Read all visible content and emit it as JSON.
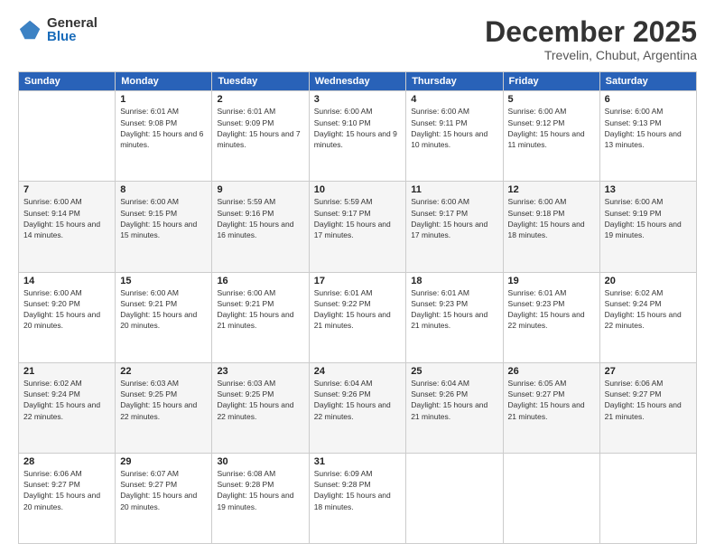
{
  "header": {
    "logo_general": "General",
    "logo_blue": "Blue",
    "month_title": "December 2025",
    "subtitle": "Trevelin, Chubut, Argentina"
  },
  "days_of_week": [
    "Sunday",
    "Monday",
    "Tuesday",
    "Wednesday",
    "Thursday",
    "Friday",
    "Saturday"
  ],
  "weeks": [
    [
      {
        "day": "",
        "sunrise": "",
        "sunset": "",
        "daylight": ""
      },
      {
        "day": "1",
        "sunrise": "Sunrise: 6:01 AM",
        "sunset": "Sunset: 9:08 PM",
        "daylight": "Daylight: 15 hours and 6 minutes."
      },
      {
        "day": "2",
        "sunrise": "Sunrise: 6:01 AM",
        "sunset": "Sunset: 9:09 PM",
        "daylight": "Daylight: 15 hours and 7 minutes."
      },
      {
        "day": "3",
        "sunrise": "Sunrise: 6:00 AM",
        "sunset": "Sunset: 9:10 PM",
        "daylight": "Daylight: 15 hours and 9 minutes."
      },
      {
        "day": "4",
        "sunrise": "Sunrise: 6:00 AM",
        "sunset": "Sunset: 9:11 PM",
        "daylight": "Daylight: 15 hours and 10 minutes."
      },
      {
        "day": "5",
        "sunrise": "Sunrise: 6:00 AM",
        "sunset": "Sunset: 9:12 PM",
        "daylight": "Daylight: 15 hours and 11 minutes."
      },
      {
        "day": "6",
        "sunrise": "Sunrise: 6:00 AM",
        "sunset": "Sunset: 9:13 PM",
        "daylight": "Daylight: 15 hours and 13 minutes."
      }
    ],
    [
      {
        "day": "7",
        "sunrise": "Sunrise: 6:00 AM",
        "sunset": "Sunset: 9:14 PM",
        "daylight": "Daylight: 15 hours and 14 minutes."
      },
      {
        "day": "8",
        "sunrise": "Sunrise: 6:00 AM",
        "sunset": "Sunset: 9:15 PM",
        "daylight": "Daylight: 15 hours and 15 minutes."
      },
      {
        "day": "9",
        "sunrise": "Sunrise: 5:59 AM",
        "sunset": "Sunset: 9:16 PM",
        "daylight": "Daylight: 15 hours and 16 minutes."
      },
      {
        "day": "10",
        "sunrise": "Sunrise: 5:59 AM",
        "sunset": "Sunset: 9:17 PM",
        "daylight": "Daylight: 15 hours and 17 minutes."
      },
      {
        "day": "11",
        "sunrise": "Sunrise: 6:00 AM",
        "sunset": "Sunset: 9:17 PM",
        "daylight": "Daylight: 15 hours and 17 minutes."
      },
      {
        "day": "12",
        "sunrise": "Sunrise: 6:00 AM",
        "sunset": "Sunset: 9:18 PM",
        "daylight": "Daylight: 15 hours and 18 minutes."
      },
      {
        "day": "13",
        "sunrise": "Sunrise: 6:00 AM",
        "sunset": "Sunset: 9:19 PM",
        "daylight": "Daylight: 15 hours and 19 minutes."
      }
    ],
    [
      {
        "day": "14",
        "sunrise": "Sunrise: 6:00 AM",
        "sunset": "Sunset: 9:20 PM",
        "daylight": "Daylight: 15 hours and 20 minutes."
      },
      {
        "day": "15",
        "sunrise": "Sunrise: 6:00 AM",
        "sunset": "Sunset: 9:21 PM",
        "daylight": "Daylight: 15 hours and 20 minutes."
      },
      {
        "day": "16",
        "sunrise": "Sunrise: 6:00 AM",
        "sunset": "Sunset: 9:21 PM",
        "daylight": "Daylight: 15 hours and 21 minutes."
      },
      {
        "day": "17",
        "sunrise": "Sunrise: 6:01 AM",
        "sunset": "Sunset: 9:22 PM",
        "daylight": "Daylight: 15 hours and 21 minutes."
      },
      {
        "day": "18",
        "sunrise": "Sunrise: 6:01 AM",
        "sunset": "Sunset: 9:23 PM",
        "daylight": "Daylight: 15 hours and 21 minutes."
      },
      {
        "day": "19",
        "sunrise": "Sunrise: 6:01 AM",
        "sunset": "Sunset: 9:23 PM",
        "daylight": "Daylight: 15 hours and 22 minutes."
      },
      {
        "day": "20",
        "sunrise": "Sunrise: 6:02 AM",
        "sunset": "Sunset: 9:24 PM",
        "daylight": "Daylight: 15 hours and 22 minutes."
      }
    ],
    [
      {
        "day": "21",
        "sunrise": "Sunrise: 6:02 AM",
        "sunset": "Sunset: 9:24 PM",
        "daylight": "Daylight: 15 hours and 22 minutes."
      },
      {
        "day": "22",
        "sunrise": "Sunrise: 6:03 AM",
        "sunset": "Sunset: 9:25 PM",
        "daylight": "Daylight: 15 hours and 22 minutes."
      },
      {
        "day": "23",
        "sunrise": "Sunrise: 6:03 AM",
        "sunset": "Sunset: 9:25 PM",
        "daylight": "Daylight: 15 hours and 22 minutes."
      },
      {
        "day": "24",
        "sunrise": "Sunrise: 6:04 AM",
        "sunset": "Sunset: 9:26 PM",
        "daylight": "Daylight: 15 hours and 22 minutes."
      },
      {
        "day": "25",
        "sunrise": "Sunrise: 6:04 AM",
        "sunset": "Sunset: 9:26 PM",
        "daylight": "Daylight: 15 hours and 21 minutes."
      },
      {
        "day": "26",
        "sunrise": "Sunrise: 6:05 AM",
        "sunset": "Sunset: 9:27 PM",
        "daylight": "Daylight: 15 hours and 21 minutes."
      },
      {
        "day": "27",
        "sunrise": "Sunrise: 6:06 AM",
        "sunset": "Sunset: 9:27 PM",
        "daylight": "Daylight: 15 hours and 21 minutes."
      }
    ],
    [
      {
        "day": "28",
        "sunrise": "Sunrise: 6:06 AM",
        "sunset": "Sunset: 9:27 PM",
        "daylight": "Daylight: 15 hours and 20 minutes."
      },
      {
        "day": "29",
        "sunrise": "Sunrise: 6:07 AM",
        "sunset": "Sunset: 9:27 PM",
        "daylight": "Daylight: 15 hours and 20 minutes."
      },
      {
        "day": "30",
        "sunrise": "Sunrise: 6:08 AM",
        "sunset": "Sunset: 9:28 PM",
        "daylight": "Daylight: 15 hours and 19 minutes."
      },
      {
        "day": "31",
        "sunrise": "Sunrise: 6:09 AM",
        "sunset": "Sunset: 9:28 PM",
        "daylight": "Daylight: 15 hours and 18 minutes."
      },
      {
        "day": "",
        "sunrise": "",
        "sunset": "",
        "daylight": ""
      },
      {
        "day": "",
        "sunrise": "",
        "sunset": "",
        "daylight": ""
      },
      {
        "day": "",
        "sunrise": "",
        "sunset": "",
        "daylight": ""
      }
    ]
  ]
}
